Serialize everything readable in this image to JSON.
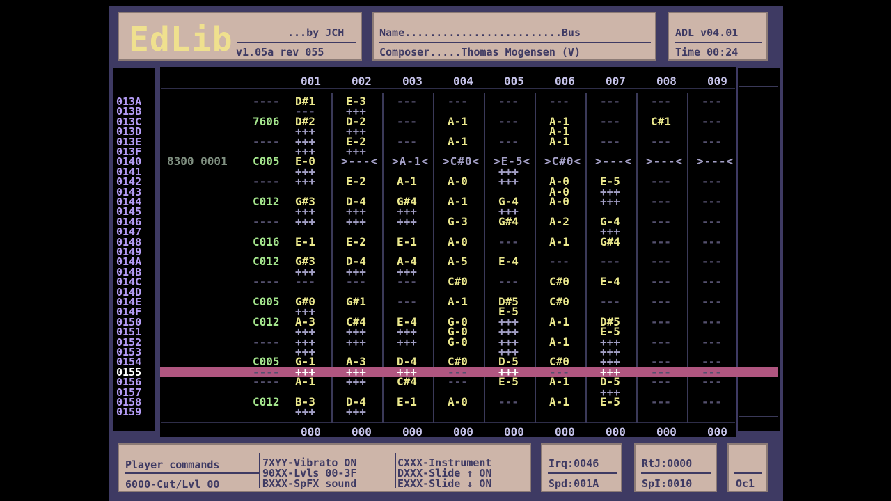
{
  "header": {
    "logo": "EdLib",
    "byline": "...by JCH",
    "version": "v1.05a rev 055",
    "name_line": "Name.........................Bus",
    "composer_line": "Composer.....Thomas Mogensen (V)",
    "adl_version": "ADL v04.01",
    "time": "Time 00:24"
  },
  "channels": [
    "001",
    "002",
    "003",
    "004",
    "005",
    "006",
    "007",
    "008",
    "009"
  ],
  "footer_steps": [
    "000",
    "000",
    "000",
    "000",
    "000",
    "000",
    "000",
    "000",
    "000"
  ],
  "rows": [
    {
      "n": "013A",
      "c": [
        "----",
        "D#1",
        "E-3",
        "---",
        "---",
        "---",
        "---",
        "---",
        "---",
        "---"
      ]
    },
    {
      "n": "013B",
      "c": [
        "",
        "---",
        "+++",
        "",
        "",
        "",
        "",
        "",
        "",
        ""
      ]
    },
    {
      "n": "013C",
      "c": [
        "7606",
        "D#2",
        "D-2",
        "---",
        "A-1",
        "---",
        "A-1",
        "---",
        "C#1",
        "---"
      ]
    },
    {
      "n": "013D",
      "c": [
        "",
        "+++",
        "+++",
        "",
        "",
        "",
        "A-1",
        "",
        "",
        ""
      ]
    },
    {
      "n": "013E",
      "c": [
        "----",
        "+++",
        "E-2",
        "---",
        "A-1",
        "---",
        "A-1",
        "---",
        "---",
        "---"
      ]
    },
    {
      "n": "013F",
      "c": [
        "",
        "+++",
        "+++",
        "",
        "",
        "",
        "",
        "",
        "",
        ""
      ]
    },
    {
      "n": "0140",
      "fx": "8300 0001",
      "c": [
        "C005",
        "E-0",
        ">---<",
        ">A-1<",
        ">C#0<",
        ">E-5<",
        ">C#0<",
        ">---<",
        ">---<",
        ">---<"
      ]
    },
    {
      "n": "0141",
      "c": [
        "",
        "+++",
        "",
        "",
        "",
        "+++",
        "",
        "",
        "",
        ""
      ]
    },
    {
      "n": "0142",
      "c": [
        "----",
        "+++",
        "E-2",
        "A-1",
        "A-0",
        "+++",
        "A-0",
        "E-5",
        "---",
        "---"
      ]
    },
    {
      "n": "0143",
      "c": [
        "",
        "",
        "",
        "",
        "",
        "",
        "A-0",
        "+++",
        "",
        ""
      ]
    },
    {
      "n": "0144",
      "c": [
        "C012",
        "G#3",
        "D-4",
        "G#4",
        "A-1",
        "G-4",
        "A-0",
        "+++",
        "---",
        "---"
      ]
    },
    {
      "n": "0145",
      "c": [
        "",
        "+++",
        "+++",
        "+++",
        "",
        "+++",
        "",
        "",
        "",
        ""
      ]
    },
    {
      "n": "0146",
      "c": [
        "----",
        "+++",
        "+++",
        "+++",
        "G-3",
        "G#4",
        "A-2",
        "G-4",
        "---",
        "---"
      ]
    },
    {
      "n": "0147",
      "c": [
        "",
        "",
        "",
        "",
        "",
        "",
        "",
        "+++",
        "",
        ""
      ]
    },
    {
      "n": "0148",
      "c": [
        "C016",
        "E-1",
        "E-2",
        "E-1",
        "A-0",
        "---",
        "A-1",
        "G#4",
        "---",
        "---"
      ]
    },
    {
      "n": "0149",
      "c": [
        "",
        "",
        "",
        "",
        "",
        "",
        "",
        "",
        "",
        ""
      ]
    },
    {
      "n": "014A",
      "c": [
        "C012",
        "G#3",
        "D-4",
        "A-4",
        "A-5",
        "E-4",
        "---",
        "---",
        "---",
        "---"
      ]
    },
    {
      "n": "014B",
      "c": [
        "",
        "+++",
        "+++",
        "+++",
        "",
        "",
        "",
        "",
        "",
        ""
      ]
    },
    {
      "n": "014C",
      "c": [
        "----",
        "---",
        "---",
        "---",
        "C#0",
        "---",
        "C#0",
        "E-4",
        "---",
        "---"
      ]
    },
    {
      "n": "014D",
      "c": [
        "",
        "",
        "",
        "",
        "",
        "",
        "",
        "",
        "",
        ""
      ]
    },
    {
      "n": "014E",
      "c": [
        "C005",
        "G#0",
        "G#1",
        "---",
        "A-1",
        "D#5",
        "C#0",
        "---",
        "---",
        "---"
      ]
    },
    {
      "n": "014F",
      "c": [
        "",
        "+++",
        "",
        "",
        "",
        "E-5",
        "",
        "",
        "",
        ""
      ]
    },
    {
      "n": "0150",
      "c": [
        "C012",
        "A-3",
        "C#4",
        "E-4",
        "G-0",
        "+++",
        "A-1",
        "D#5",
        "---",
        "---"
      ]
    },
    {
      "n": "0151",
      "c": [
        "",
        "+++",
        "+++",
        "+++",
        "G-0",
        "+++",
        "",
        "E-5",
        "",
        ""
      ]
    },
    {
      "n": "0152",
      "c": [
        "----",
        "+++",
        "+++",
        "+++",
        "G-0",
        "+++",
        "A-1",
        "+++",
        "---",
        "---"
      ]
    },
    {
      "n": "0153",
      "c": [
        "",
        "+++",
        "",
        "",
        "",
        "+++",
        "",
        "+++",
        "",
        ""
      ]
    },
    {
      "n": "0154",
      "c": [
        "C005",
        "G-1",
        "A-3",
        "D-4",
        "C#0",
        "D-5",
        "C#0",
        "+++",
        "---",
        "---"
      ]
    },
    {
      "n": "0155",
      "c": [
        "----",
        "+++",
        "+++",
        "+++",
        "---",
        "+++",
        "---",
        "+++",
        "---",
        "---"
      ]
    },
    {
      "n": "0156",
      "c": [
        "----",
        "A-1",
        "+++",
        "C#4",
        "---",
        "E-5",
        "A-1",
        "D-5",
        "---",
        "---"
      ]
    },
    {
      "n": "0157",
      "c": [
        "",
        "",
        "",
        "",
        "",
        "",
        "",
        "+++",
        "",
        ""
      ]
    },
    {
      "n": "0158",
      "c": [
        "C012",
        "B-3",
        "D-4",
        "E-1",
        "A-0",
        "---",
        "A-1",
        "E-5",
        "---",
        "---"
      ]
    },
    {
      "n": "0159",
      "c": [
        "",
        "+++",
        "+++",
        "",
        "",
        "",
        "",
        "",
        "",
        ""
      ]
    }
  ],
  "status": {
    "player_title": "Player commands",
    "cut_cmd": "6000-Cut/Lvl 00",
    "cmd_vibrato": "7XYY-Vibrato ON",
    "cmd_levels": "90XX-Lvls 00-3F",
    "cmd_spfx": "BXXX-SpFX sound",
    "cmd_instrument": "CXXX-Instrument",
    "cmd_slide_up": "DXXX-Slide ↑ ON",
    "cmd_slide_down": "EXXX-Slide ↓ ON",
    "irq": "Irq:0046",
    "speed": "Spd:001A",
    "rtj": "RtJ:0000",
    "spi": "SpI:0010",
    "octave": "Oc1"
  },
  "colors": {
    "background": "#3e3a63",
    "panel": "#cdb5a9",
    "cursor": "#b05680",
    "note": "#ece98d",
    "instrument": "#a4e58d"
  }
}
